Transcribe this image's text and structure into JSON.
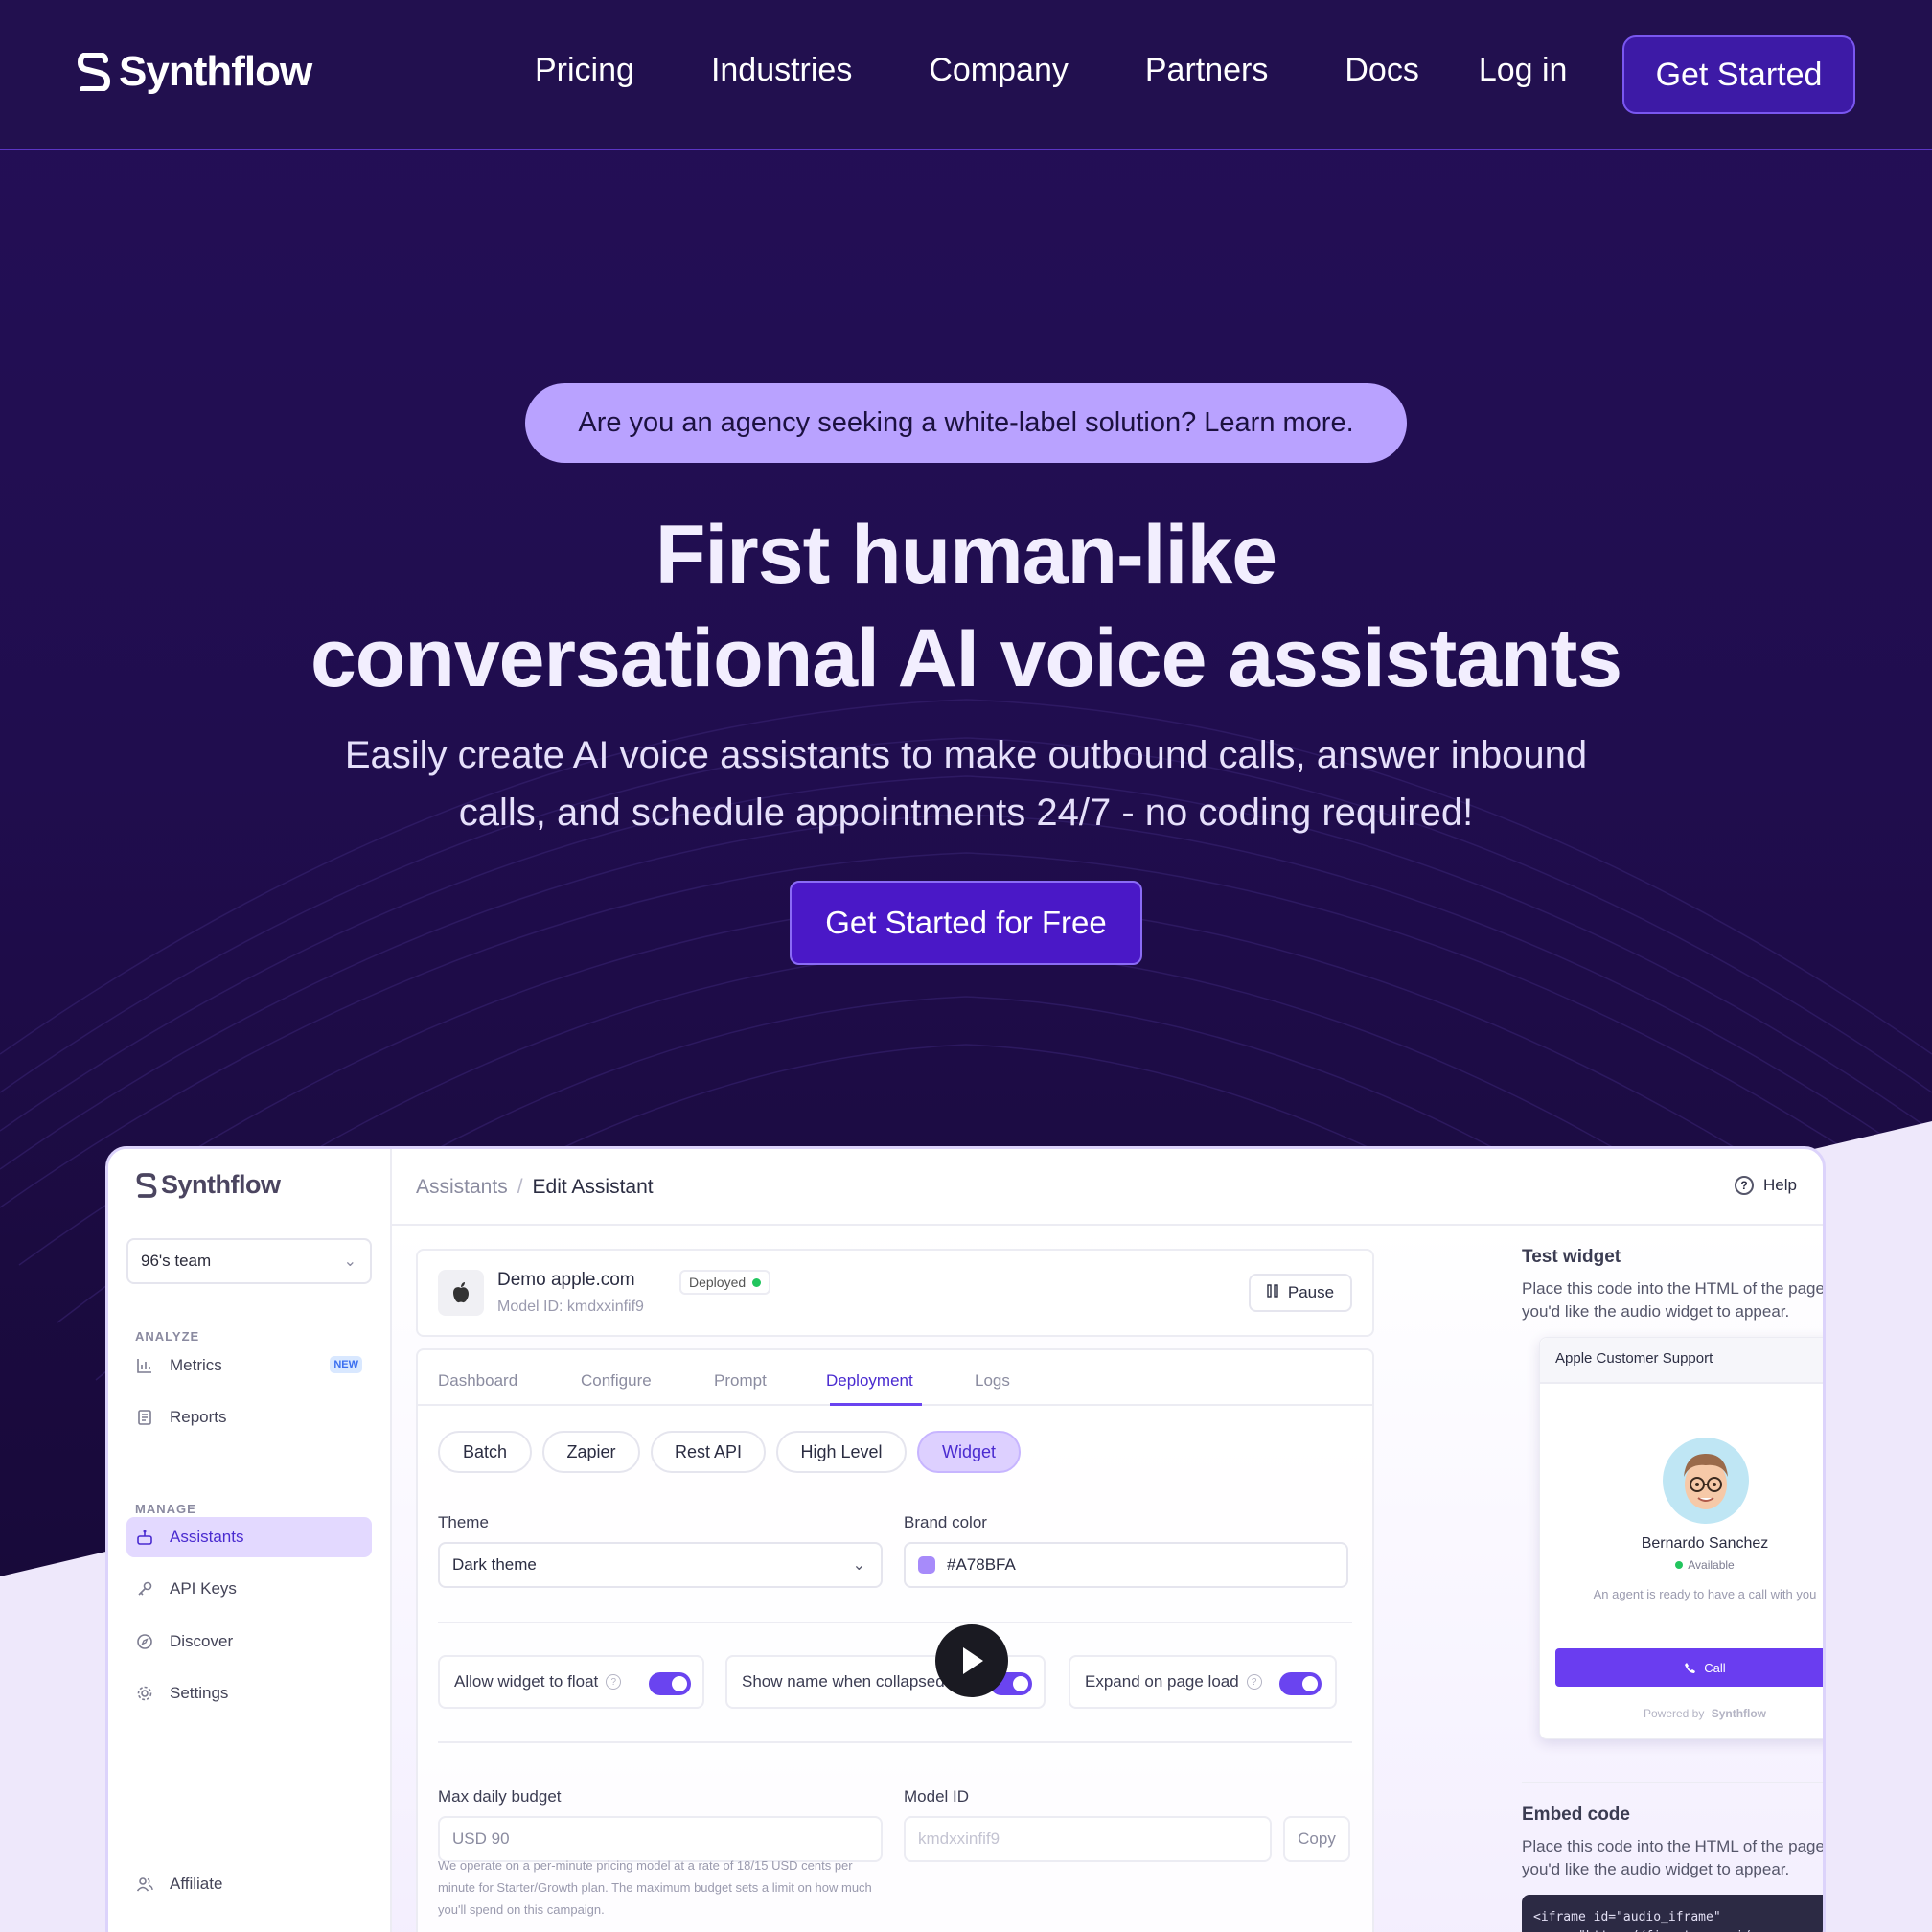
{
  "nav": {
    "logo_text": "Synthflow",
    "links": [
      "Pricing",
      "Industries",
      "Company",
      "Partners",
      "Docs",
      "Log in"
    ],
    "cta_label": "Get Started"
  },
  "hero": {
    "pill_text": "Are you an agency seeking a white-label solution? Learn more.",
    "title_line1": "First human-like",
    "title_line2": "conversational AI voice assistants",
    "subtitle_line1": "Easily create AI voice assistants to make outbound calls, answer inbound",
    "subtitle_line2": "calls, and schedule appointments 24/7 - no coding required!",
    "cta_label": "Get Started for Free"
  },
  "app": {
    "logo_text": "Synthflow",
    "team_select": "96's team",
    "sections": {
      "analyze": "ANALYZE",
      "manage": "MANAGE"
    },
    "sidebar_items": {
      "metrics": "Metrics",
      "metrics_badge": "NEW",
      "reports": "Reports",
      "assistants": "Assistants",
      "api_keys": "API Keys",
      "discover": "Discover",
      "settings": "Settings",
      "affiliate": "Affiliate"
    },
    "breadcrumb": {
      "parent": "Assistants",
      "separator": "/",
      "current": "Edit Assistant"
    },
    "help_label": "Help",
    "assistant": {
      "name": "Demo apple.com",
      "model_id_line": "Model ID: kmdxxinfif9",
      "status": "Deployed",
      "pause_label": "Pause"
    },
    "tabs": [
      "Dashboard",
      "Configure",
      "Prompt",
      "Deployment",
      "Logs"
    ],
    "active_tab": "Deployment",
    "chips": [
      "Batch",
      "Zapier",
      "Rest API",
      "High Level",
      "Widget"
    ],
    "active_chip": "Widget",
    "theme": {
      "label": "Theme",
      "value": "Dark theme"
    },
    "brand_color": {
      "label": "Brand color",
      "value": "#A78BFA",
      "swatch": "#a78bfa"
    },
    "toggles": [
      {
        "label": "Allow widget to float",
        "on": true
      },
      {
        "label": "Show name when collapsed",
        "on": true
      },
      {
        "label": "Expand on page load",
        "on": true
      }
    ],
    "max_budget": {
      "label": "Max daily budget",
      "value": "USD 90",
      "note": "We operate on a per-minute pricing model at a rate of 18/15 USD cents per minute for Starter/Growth plan. The maximum budget sets a limit on how much you'll spend on this campaign."
    },
    "model_id": {
      "label": "Model ID",
      "value": "kmdxxinfif9",
      "copy_label": "Copy"
    },
    "test_widget": {
      "title": "Test widget",
      "description": "Place this code into the HTML of the pages where you'd like the audio widget to appear.",
      "header": "Apple Customer Support",
      "agent_name": "Bernardo Sanchez",
      "agent_status": "Available",
      "message": "An agent is ready to have a call with you",
      "call_label": "Call",
      "powered_by": "Powered by",
      "powered_brand": "Synthflow"
    },
    "embed": {
      "title": "Embed code",
      "description": "Place this code into the HTML of the pages where you'd like the audio widget to appear.",
      "code": "<iframe id=\"audio_iframe\"\n  src=\"https://fine-tuner.ai/"
    }
  },
  "colors": {
    "accent": "#6a44f0",
    "nav_bg": "#22104f",
    "pill_bg": "#b9a2ff",
    "cta_bg": "#4a18c7"
  }
}
